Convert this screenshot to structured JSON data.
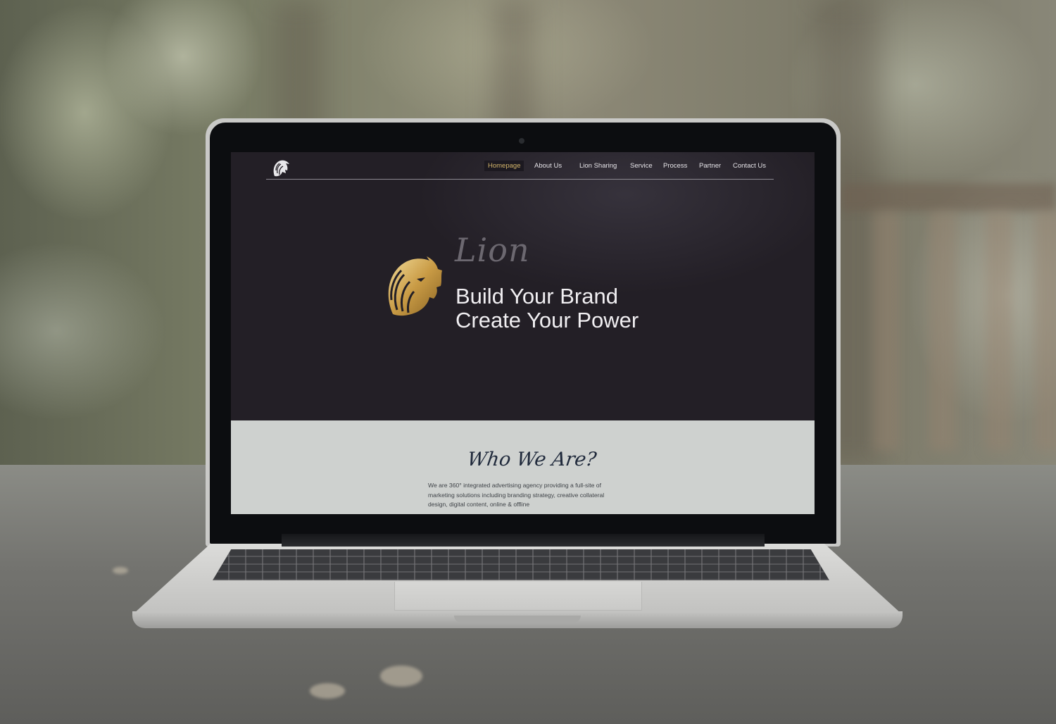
{
  "website": {
    "nav": {
      "items": [
        {
          "label": "Homepage",
          "active": true
        },
        {
          "label": "About Us",
          "active": false
        },
        {
          "label": "Lion Sharing",
          "active": false
        },
        {
          "label": "Service",
          "active": false
        },
        {
          "label": "Process",
          "active": false
        },
        {
          "label": "Partner",
          "active": false
        },
        {
          "label": "Contact Us",
          "active": false
        }
      ]
    },
    "hero": {
      "script_word": "Lion",
      "headline_line1": "Build Your Brand",
      "headline_line2": "Create Your Power"
    },
    "about": {
      "title": "Who We Are?",
      "body": "We are 360° integrated advertising agency providing a full-site of marketing solutions including branding strategy, creative collateral design, digital content, online & offline"
    }
  },
  "colors": {
    "hero_background": "#231f26",
    "accent_gold": "#d3b46a",
    "about_background": "#ced1cf",
    "about_title": "#202a3c"
  },
  "icons": [
    "lion-logo-icon",
    "lion-head-gold-icon",
    "camera-icon"
  ]
}
